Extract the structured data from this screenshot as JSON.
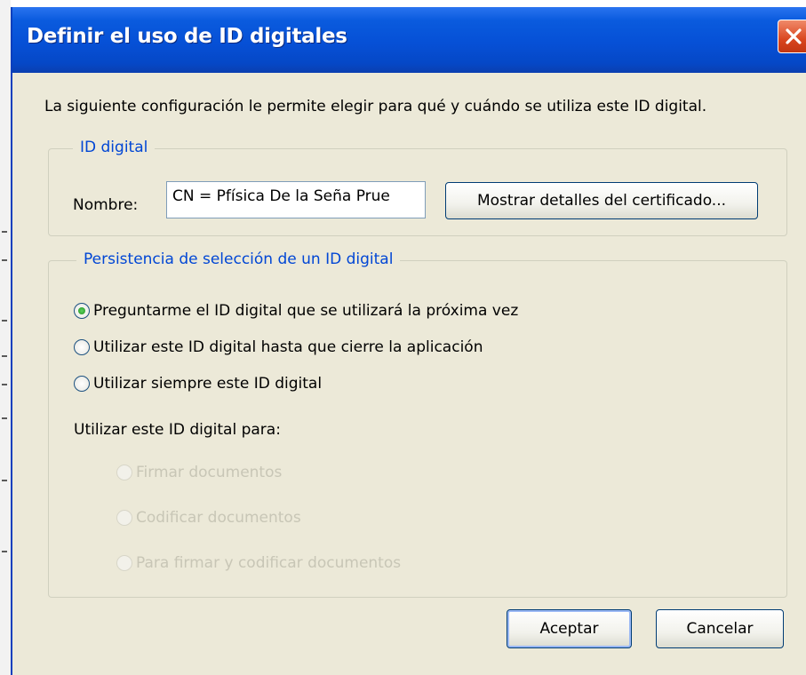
{
  "window": {
    "title": "Definir el uso de ID digitales",
    "intro": "La siguiente configuración le permite elegir para qué y cuándo se utiliza este ID digital."
  },
  "id_group": {
    "legend": "ID digital",
    "name_label": "Nombre:",
    "name_value": "CN = Pfísica De la Seña Prue",
    "details_button": "Mostrar detalles del certificado..."
  },
  "persistence_group": {
    "legend": "Persistencia de selección de un ID digital",
    "options": [
      {
        "label": "Preguntarme el ID digital que se utilizará la próxima vez",
        "checked": true
      },
      {
        "label": "Utilizar este ID digital hasta que cierre la aplicación",
        "checked": false
      },
      {
        "label": "Utilizar siempre este ID digital",
        "checked": false
      }
    ],
    "use_for_label": "Utilizar este ID digital para:",
    "use_options": [
      {
        "label": "Firmar documentos",
        "enabled": false
      },
      {
        "label": "Codificar documentos",
        "enabled": false
      },
      {
        "label": "Para firmar y codificar documentos",
        "enabled": false
      }
    ]
  },
  "buttons": {
    "ok": "Aceptar",
    "cancel": "Cancelar"
  },
  "colors": {
    "titlebar": "#0650d6",
    "dialog_bg": "#ece9d8",
    "legend_text": "#0046d5",
    "close_button": "#d9461f"
  },
  "icons": {
    "close": "close-icon",
    "radio_checked": "radio-checked-icon"
  }
}
